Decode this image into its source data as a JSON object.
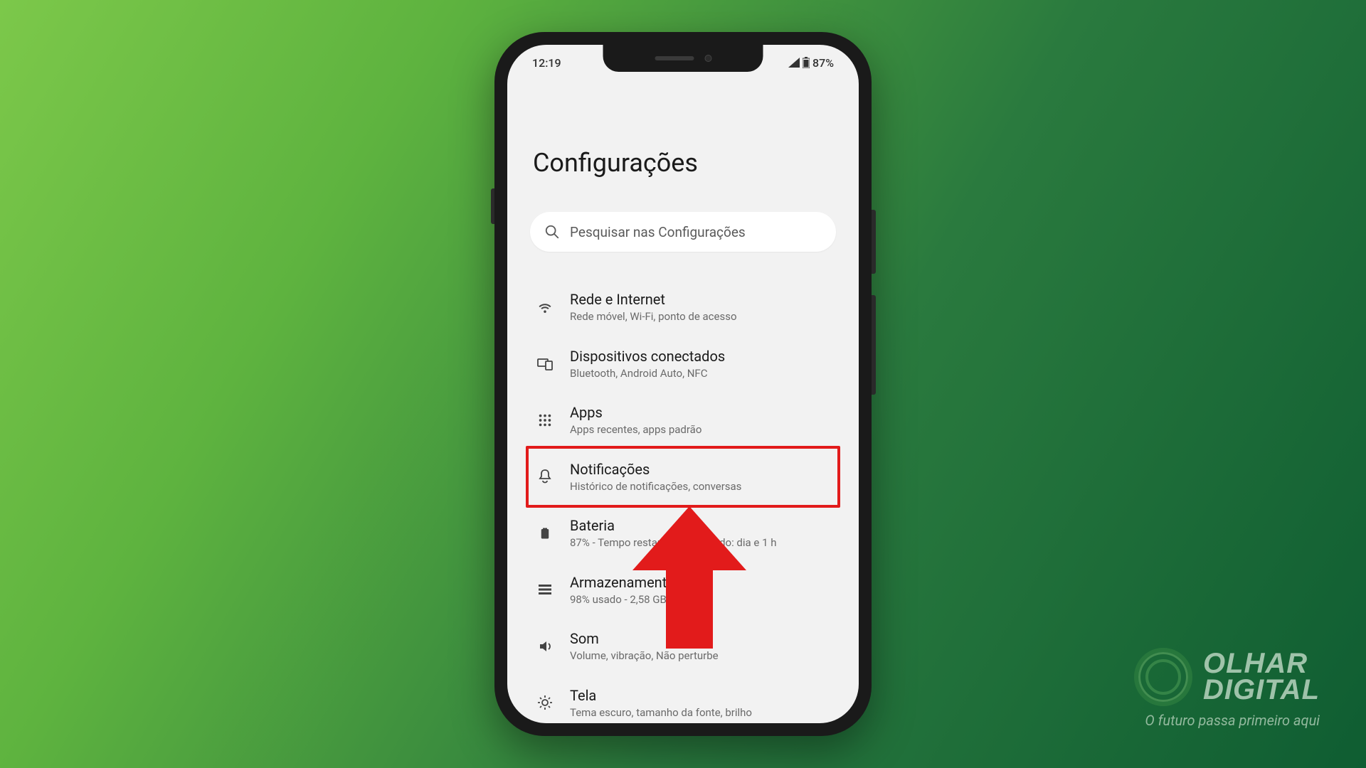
{
  "status": {
    "time": "12:19",
    "battery_text": "87%"
  },
  "page_title": "Configurações",
  "search": {
    "placeholder": "Pesquisar nas Configurações"
  },
  "settings": [
    {
      "icon": "wifi",
      "title": "Rede e Internet",
      "subtitle": "Rede móvel, Wi-Fi, ponto de acesso"
    },
    {
      "icon": "devices",
      "title": "Dispositivos conectados",
      "subtitle": "Bluetooth, Android Auto, NFC"
    },
    {
      "icon": "apps",
      "title": "Apps",
      "subtitle": "Apps recentes, apps padrão"
    },
    {
      "icon": "bell",
      "title": "Notificações",
      "subtitle": "Histórico de notificações, conversas"
    },
    {
      "icon": "battery",
      "title": "Bateria",
      "subtitle": "87% - Tempo restante aproximado: dia e 1 h"
    },
    {
      "icon": "storage",
      "title": "Armazenamento",
      "subtitle": "98% usado - 2,58 GB livre(s)"
    },
    {
      "icon": "sound",
      "title": "Som",
      "subtitle": "Volume, vibração, Não perturbe"
    },
    {
      "icon": "display",
      "title": "Tela",
      "subtitle": "Tema escuro, tamanho da fonte, brilho"
    }
  ],
  "highlighted_index": 3,
  "watermark": {
    "line1": "OLHAR",
    "line2": "DIGITAL",
    "tagline": "O futuro passa primeiro aqui"
  }
}
